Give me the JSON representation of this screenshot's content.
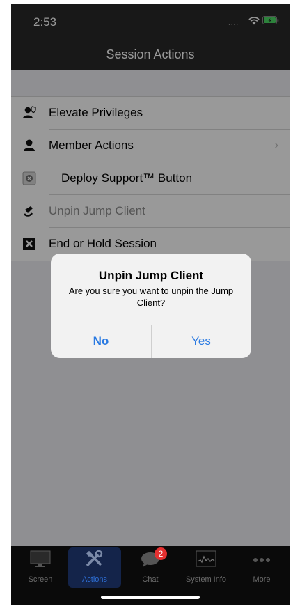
{
  "status": {
    "time": "2:53",
    "signal": "....",
    "wifi_icon": "wifi-icon",
    "battery_icon": "battery-icon"
  },
  "nav": {
    "title": "Session Actions"
  },
  "list": [
    {
      "label": "Elevate Privileges",
      "icon": "elevate-user-icon",
      "chevron": false,
      "enabled": true
    },
    {
      "label": "Member Actions",
      "icon": "member-user-icon",
      "chevron": true,
      "enabled": true
    },
    {
      "label": "Deploy Support™ Button",
      "icon": "support-button-icon",
      "chevron": false,
      "enabled": true
    },
    {
      "label": "Unpin Jump Client",
      "icon": "jump-client-icon",
      "chevron": false,
      "enabled": false
    },
    {
      "label": "End or Hold Session",
      "icon": "end-session-icon",
      "chevron": false,
      "enabled": true
    }
  ],
  "dialog": {
    "title": "Unpin Jump Client",
    "message": "Are you sure you want to unpin the Jump Client?",
    "no_label": "No",
    "yes_label": "Yes"
  },
  "tabs": [
    {
      "label": "Screen",
      "icon": "screen-icon",
      "active": false
    },
    {
      "label": "Actions",
      "icon": "tools-icon",
      "active": true
    },
    {
      "label": "Chat",
      "icon": "chat-icon",
      "active": false,
      "badge": "2"
    },
    {
      "label": "System Info",
      "icon": "system-info-icon",
      "active": false
    },
    {
      "label": "More",
      "icon": "more-icon",
      "active": false
    }
  ],
  "colors": {
    "accent": "#2a7ae2",
    "active_tab_bg": "#14244a",
    "badge": "#e53030"
  }
}
